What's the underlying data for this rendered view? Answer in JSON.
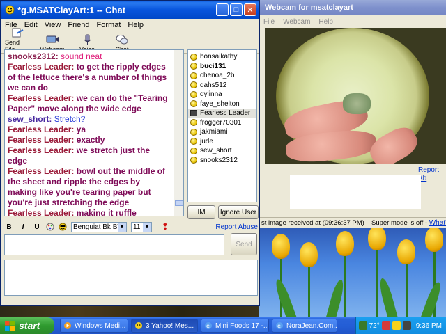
{
  "chat_window": {
    "title": "*g.MSATClayArt:1 -- Chat",
    "menu": [
      "File",
      "Edit",
      "View",
      "Friend",
      "Format",
      "Help"
    ],
    "toolbar": [
      {
        "label": "Send File",
        "icon": "send-file-icon"
      },
      {
        "label": "Webcam",
        "icon": "webcam-icon"
      },
      {
        "label": "Voice",
        "icon": "microphone-icon"
      },
      {
        "label": "Chat",
        "icon": "chat-bubbles-icon"
      }
    ],
    "messages": [
      {
        "who": "snooks2312:",
        "text": "sound neat",
        "style": "sn"
      },
      {
        "who": "Fearless Leader:",
        "text": "to get the ripply edges of the lettuce there's a number of things we can do",
        "style": "fl"
      },
      {
        "who": "Fearless Leader:",
        "text": "we can do the \"Tearing Paper\" move along the wide edge",
        "style": "fl"
      },
      {
        "who": "sew_short:",
        "text": "Stretch?",
        "style": "sw"
      },
      {
        "who": "Fearless Leader:",
        "text": "ya",
        "style": "fl"
      },
      {
        "who": "Fearless Leader:",
        "text": "exactly",
        "style": "fl"
      },
      {
        "who": "Fearless Leader:",
        "text": "we stretch just the edge",
        "style": "fl"
      },
      {
        "who": "Fearless Leader:",
        "text": "bowl out the middle of the sheet and ripple the edges by making like you're tearing paper but you're just stretching the edge",
        "style": "fl"
      },
      {
        "who": "Fearless Leader:",
        "text": "making it ruffle",
        "style": "fl"
      }
    ],
    "users": [
      {
        "name": "bonsaikathy",
        "bold": false,
        "selected": false,
        "cam": false
      },
      {
        "name": "buci131",
        "bold": true,
        "selected": false,
        "cam": false
      },
      {
        "name": "chenoa_2b",
        "bold": false,
        "selected": false,
        "cam": false
      },
      {
        "name": "dahs512",
        "bold": false,
        "selected": false,
        "cam": false
      },
      {
        "name": "dylinna",
        "bold": false,
        "selected": false,
        "cam": false
      },
      {
        "name": "faye_shelton",
        "bold": false,
        "selected": false,
        "cam": false
      },
      {
        "name": "Fearless Leader",
        "bold": false,
        "selected": true,
        "cam": true
      },
      {
        "name": "frogger70301",
        "bold": false,
        "selected": false,
        "cam": false
      },
      {
        "name": "jakmiami",
        "bold": false,
        "selected": false,
        "cam": false
      },
      {
        "name": "jude",
        "bold": false,
        "selected": false,
        "cam": false
      },
      {
        "name": "sew_short",
        "bold": false,
        "selected": false,
        "cam": false
      },
      {
        "name": "snooks2312",
        "bold": false,
        "selected": false,
        "cam": false
      }
    ],
    "im_button": "IM",
    "ignore_button": "Ignore User",
    "format": {
      "bold": "B",
      "italic": "I",
      "underline": "U",
      "font": "Benguiat Bk BT",
      "size": "11",
      "report_abuse": "Report Abuse"
    },
    "send_button": "Send"
  },
  "webcam_window": {
    "title": "Webcam for msatclayart",
    "menu": [
      "File",
      "Webcam",
      "Help"
    ],
    "report_link": "Report Ab",
    "status_left": "st image received at (09:36:37 PM)",
    "status_right_prefix": "Super mode is off -",
    "status_right_link": "What's th"
  },
  "taskbar": {
    "start": "start",
    "tasks": [
      {
        "label": "Windows Medi...",
        "icon": "media-player-icon",
        "active": false
      },
      {
        "label": "3 Yahoo! Mes...",
        "icon": "yahoo-messenger-icon",
        "active": true
      },
      {
        "label": "Mini Foods 17 -...",
        "icon": "browser-icon",
        "active": false
      },
      {
        "label": "NoraJean.Com...",
        "icon": "browser-icon",
        "active": false
      }
    ],
    "tray_temp": "72°",
    "clock": "9:36 PM"
  },
  "colors": {
    "fearless_leader": "#9b1c3a",
    "message_text": "#7e0a57",
    "link": "#0033cc",
    "titlebar": "#0855dd",
    "taskbar": "#245ed6"
  }
}
